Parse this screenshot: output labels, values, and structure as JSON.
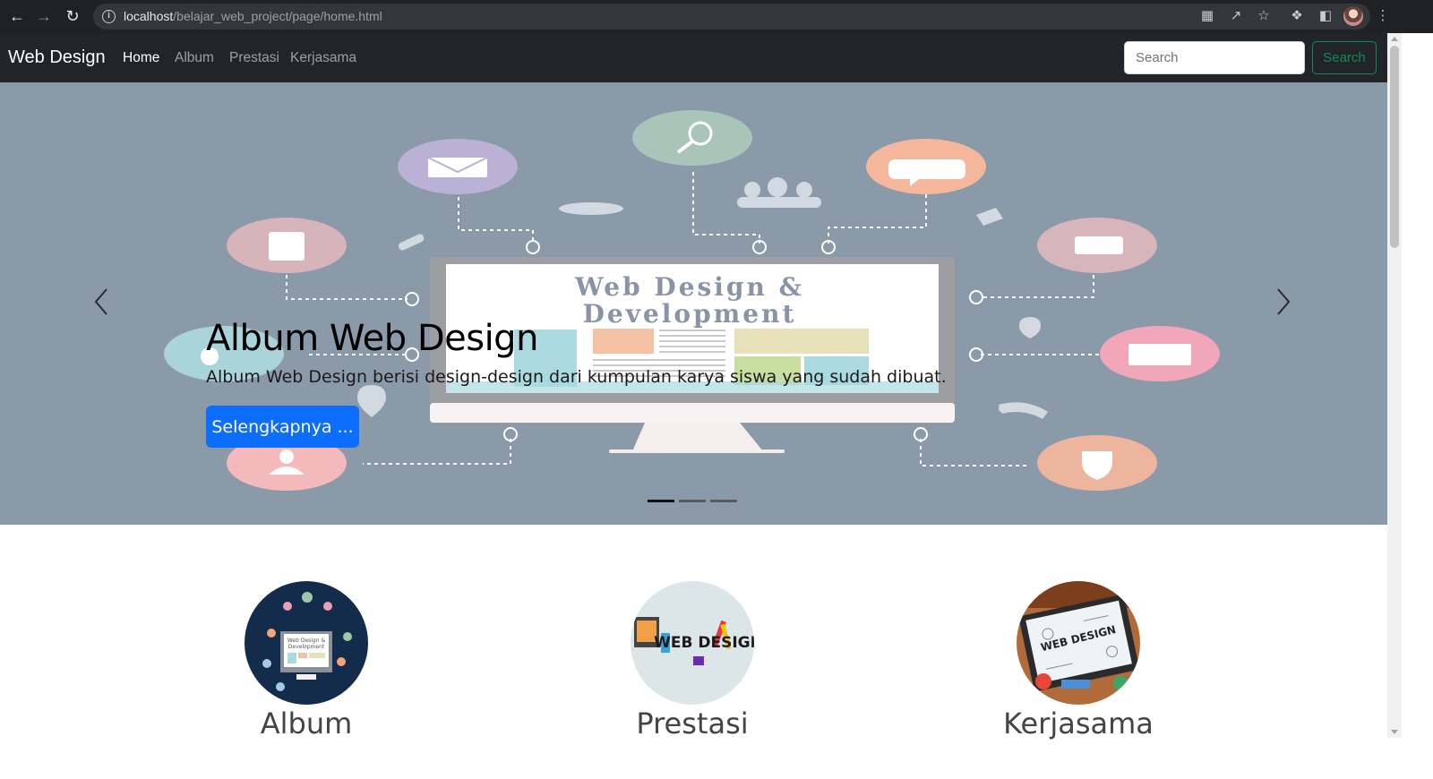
{
  "browser": {
    "url_host": "localhost",
    "url_path": "/belajar_web_project/page/home.html"
  },
  "navbar": {
    "brand": "Web Design",
    "links": [
      {
        "label": "Home",
        "active": true
      },
      {
        "label": "Album",
        "active": false
      },
      {
        "label": "Prestasi",
        "active": false
      },
      {
        "label": "Kerjasama",
        "active": false
      }
    ],
    "search_placeholder": "Search",
    "search_button": "Search"
  },
  "carousel": {
    "title": "Album Web Design",
    "text": "Album Web Design berisi design-design dari kumpulan karya siswa yang sudah dibuat.",
    "button": "Selengkapnya ...",
    "image_text_line1": "Web Design &",
    "image_text_line2": "Development",
    "slides_count": 3,
    "active_slide": 1
  },
  "features": [
    {
      "label": "Album",
      "image_text": "Web Design & Development"
    },
    {
      "label": "Prestasi",
      "image_text": "WEB DESIGN"
    },
    {
      "label": "Kerjasama",
      "image_text": "WEB DESIGN"
    }
  ],
  "colors": {
    "navbar_bg": "#212529",
    "primary": "#0d6efd",
    "success": "#198754",
    "carousel_bg": "#8b9aa9"
  }
}
